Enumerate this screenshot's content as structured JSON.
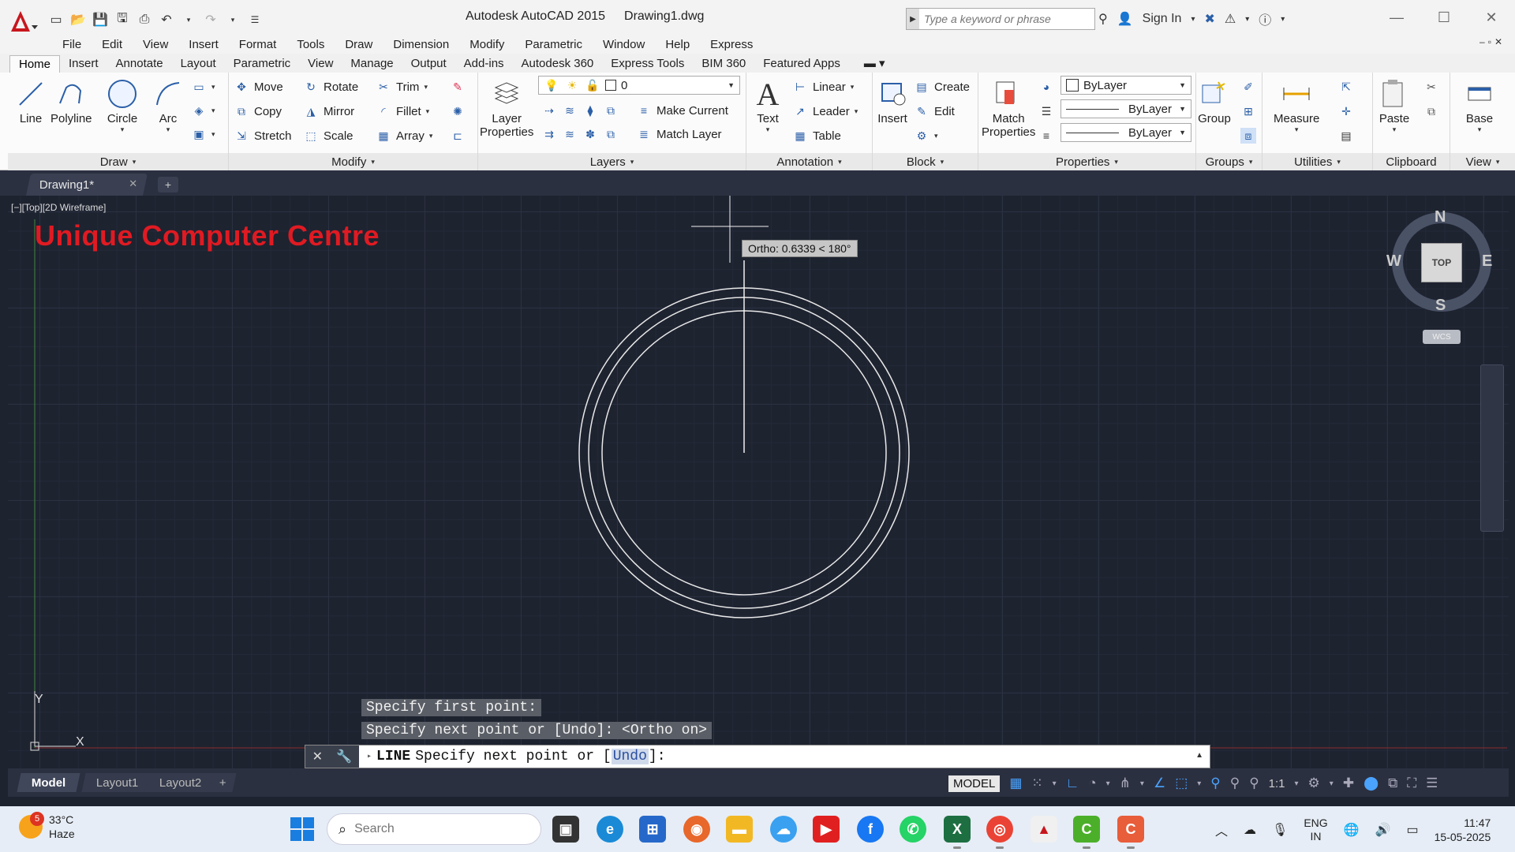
{
  "window": {
    "app_name": "Autodesk AutoCAD 2015",
    "file_name": "Drawing1.dwg",
    "search_placeholder": "Type a keyword or phrase",
    "sign_in": "Sign In"
  },
  "menu": [
    "File",
    "Edit",
    "View",
    "Insert",
    "Format",
    "Tools",
    "Draw",
    "Dimension",
    "Modify",
    "Parametric",
    "Window",
    "Help",
    "Express"
  ],
  "ribbon_tabs": [
    "Home",
    "Insert",
    "Annotate",
    "Layout",
    "Parametric",
    "View",
    "Manage",
    "Output",
    "Add-ins",
    "Autodesk 360",
    "Express Tools",
    "BIM 360",
    "Featured Apps"
  ],
  "ribbon": {
    "draw": {
      "title": "Draw",
      "line": "Line",
      "polyline": "Polyline",
      "circle": "Circle",
      "arc": "Arc"
    },
    "modify": {
      "title": "Modify",
      "move": "Move",
      "rotate": "Rotate",
      "trim": "Trim",
      "copy": "Copy",
      "mirror": "Mirror",
      "fillet": "Fillet",
      "stretch": "Stretch",
      "scale": "Scale",
      "array": "Array"
    },
    "layers": {
      "title": "Layers",
      "layer_properties_1": "Layer",
      "layer_properties_2": "Properties",
      "current_layer": "0",
      "make_current": "Make Current",
      "match_layer": "Match Layer"
    },
    "annotation": {
      "title": "Annotation",
      "text": "Text",
      "linear": "Linear",
      "leader": "Leader",
      "table": "Table"
    },
    "block": {
      "title": "Block",
      "insert": "Insert",
      "create": "Create",
      "edit": "Edit"
    },
    "properties": {
      "title": "Properties",
      "match_1": "Match",
      "match_2": "Properties",
      "color": "ByLayer",
      "lineweight": "ByLayer",
      "linetype": "ByLayer"
    },
    "groups": {
      "title": "Groups",
      "group": "Group"
    },
    "utilities": {
      "title": "Utilities",
      "measure": "Measure"
    },
    "clipboard": {
      "title": "Clipboard",
      "paste": "Paste"
    },
    "view": {
      "title": "View",
      "base": "Base"
    }
  },
  "doc_tab": "Drawing1*",
  "viewport_label": "[−][Top][2D Wireframe]",
  "watermark": "Unique Computer Centre",
  "ortho_tooltip": "Ortho: 0.6339 < 180°",
  "viewcube": {
    "n": "N",
    "s": "S",
    "e": "E",
    "w": "W",
    "top": "TOP",
    "wcs": "WCS"
  },
  "ucs": {
    "x": "X",
    "y": "Y"
  },
  "command": {
    "history": [
      "Specify first point:",
      "Specify next point or [Undo]:  <Ortho on>"
    ],
    "name": "LINE",
    "prompt_start": "Specify next point or [",
    "option": "Undo",
    "prompt_end": "]:"
  },
  "layout_tabs": [
    "Model",
    "Layout1",
    "Layout2"
  ],
  "status": {
    "model": "MODEL",
    "scale": "1:1"
  },
  "taskbar": {
    "weather_temp": "33°C",
    "weather_desc": "Haze",
    "weather_badge": "5",
    "search_placeholder": "Search",
    "lang_1": "ENG",
    "lang_2": "IN",
    "time": "11:47",
    "date": "15-05-2025"
  },
  "colors": {
    "accent": "#2b5fa8",
    "watermark": "#e01a22",
    "canvas": "#1e2330"
  }
}
